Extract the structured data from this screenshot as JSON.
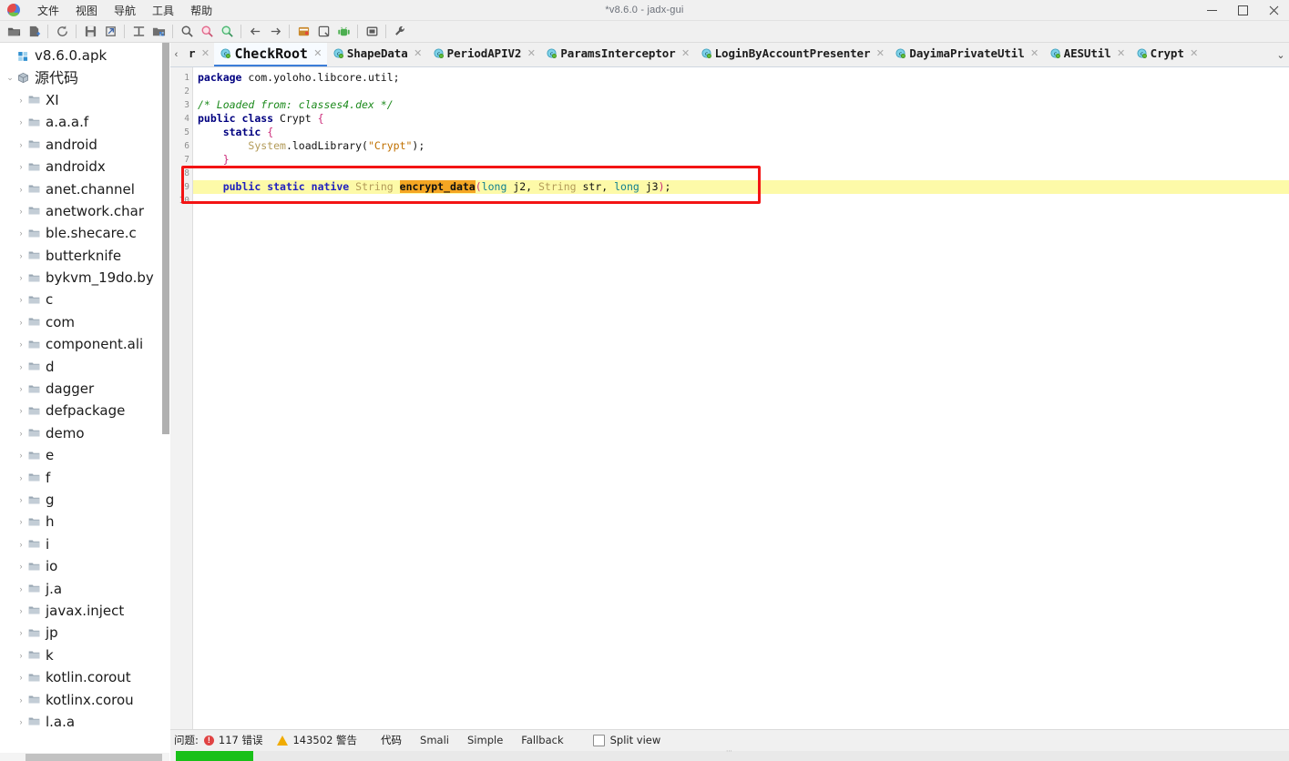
{
  "window": {
    "title": "*v8.6.0 - jadx-gui",
    "minimize": "—",
    "maximize": "▢",
    "close": "✕"
  },
  "menu": {
    "items": [
      {
        "label": "文件"
      },
      {
        "label": "视图"
      },
      {
        "label": "导航"
      },
      {
        "label": "工具"
      },
      {
        "label": "帮助"
      }
    ]
  },
  "toolbar": {
    "buttons": [
      {
        "name": "open-file-icon",
        "title": "打开文件"
      },
      {
        "name": "add-files-icon",
        "title": "添加文件"
      },
      {
        "name": "reload-icon",
        "title": "重新加载"
      },
      {
        "name": "save-icon",
        "title": "保存"
      },
      {
        "name": "export-icon",
        "title": "导出"
      },
      {
        "name": "sync-icon",
        "title": "同步"
      },
      {
        "name": "flat-packages-icon",
        "title": "平铺包"
      },
      {
        "name": "search-icon",
        "title": "搜索"
      },
      {
        "name": "search-class-icon",
        "title": "搜索类"
      },
      {
        "name": "search-comment-icon",
        "title": "搜索注释"
      },
      {
        "name": "back-icon",
        "title": "后退"
      },
      {
        "name": "forward-icon",
        "title": "前进"
      },
      {
        "name": "deobfuscation-icon",
        "title": "反混淆"
      },
      {
        "name": "quark-icon",
        "title": "Quark"
      },
      {
        "name": "android-icon",
        "title": "Android"
      },
      {
        "name": "log-icon",
        "title": "日志"
      },
      {
        "name": "preferences-icon",
        "title": "首选项"
      }
    ]
  },
  "tree": {
    "scroll_left_arrow": "‹",
    "nodes": [
      {
        "level": 0,
        "label": "v8.6.0.apk",
        "icon": "apk-icon",
        "twist": "",
        "cjk": false
      },
      {
        "level": 0,
        "label": "源代码",
        "icon": "source-icon",
        "twist": "⌄",
        "cjk": true
      },
      {
        "level": 1,
        "label": "XI",
        "icon": "package-icon",
        "twist": "›",
        "cjk": false
      },
      {
        "level": 1,
        "label": "a.a.a.f",
        "icon": "package-icon",
        "twist": "›",
        "cjk": false
      },
      {
        "level": 1,
        "label": "android",
        "icon": "package-icon",
        "twist": "›",
        "cjk": false
      },
      {
        "level": 1,
        "label": "androidx",
        "icon": "package-icon",
        "twist": "›",
        "cjk": false
      },
      {
        "level": 1,
        "label": "anet.channel",
        "icon": "package-icon",
        "twist": "›",
        "cjk": false
      },
      {
        "level": 1,
        "label": "anetwork.char",
        "icon": "package-icon",
        "twist": "›",
        "cjk": false
      },
      {
        "level": 1,
        "label": "ble.shecare.c",
        "icon": "package-icon",
        "twist": "›",
        "cjk": false
      },
      {
        "level": 1,
        "label": "butterknife",
        "icon": "package-icon",
        "twist": "›",
        "cjk": false
      },
      {
        "level": 1,
        "label": "bykvm_19do.by",
        "icon": "package-icon",
        "twist": "›",
        "cjk": false
      },
      {
        "level": 1,
        "label": "c",
        "icon": "package-icon",
        "twist": "›",
        "cjk": false
      },
      {
        "level": 1,
        "label": "com",
        "icon": "package-icon",
        "twist": "›",
        "cjk": false
      },
      {
        "level": 1,
        "label": "component.ali",
        "icon": "package-icon",
        "twist": "›",
        "cjk": false
      },
      {
        "level": 1,
        "label": "d",
        "icon": "package-icon",
        "twist": "›",
        "cjk": false
      },
      {
        "level": 1,
        "label": "dagger",
        "icon": "package-icon",
        "twist": "›",
        "cjk": false
      },
      {
        "level": 1,
        "label": "defpackage",
        "icon": "package-icon",
        "twist": "›",
        "cjk": false
      },
      {
        "level": 1,
        "label": "demo",
        "icon": "package-icon",
        "twist": "›",
        "cjk": false
      },
      {
        "level": 1,
        "label": "e",
        "icon": "package-icon",
        "twist": "›",
        "cjk": false
      },
      {
        "level": 1,
        "label": "f",
        "icon": "package-icon",
        "twist": "›",
        "cjk": false
      },
      {
        "level": 1,
        "label": "g",
        "icon": "package-icon",
        "twist": "›",
        "cjk": false
      },
      {
        "level": 1,
        "label": "h",
        "icon": "package-icon",
        "twist": "›",
        "cjk": false
      },
      {
        "level": 1,
        "label": "i",
        "icon": "package-icon",
        "twist": "›",
        "cjk": false
      },
      {
        "level": 1,
        "label": "io",
        "icon": "package-icon",
        "twist": "›",
        "cjk": false
      },
      {
        "level": 1,
        "label": "j.a",
        "icon": "package-icon",
        "twist": "›",
        "cjk": false
      },
      {
        "level": 1,
        "label": "javax.inject",
        "icon": "package-icon",
        "twist": "›",
        "cjk": false
      },
      {
        "level": 1,
        "label": "jp",
        "icon": "package-icon",
        "twist": "›",
        "cjk": false
      },
      {
        "level": 1,
        "label": "k",
        "icon": "package-icon",
        "twist": "›",
        "cjk": false
      },
      {
        "level": 1,
        "label": "kotlin.corout",
        "icon": "package-icon",
        "twist": "›",
        "cjk": false
      },
      {
        "level": 1,
        "label": "kotlinx.corou",
        "icon": "package-icon",
        "twist": "›",
        "cjk": false
      },
      {
        "level": 1,
        "label": "l.a.a",
        "icon": "package-icon",
        "twist": "›",
        "cjk": false
      }
    ]
  },
  "tabs": {
    "scroll_left": "‹",
    "overflow_menu": "⌄",
    "close_glyph": "✕",
    "items": [
      {
        "label": "r",
        "active": false,
        "partial": true
      },
      {
        "label": "CheckRoot",
        "active": true,
        "partial": false
      },
      {
        "label": "ShapeData",
        "active": false,
        "partial": false
      },
      {
        "label": "PeriodAPIV2",
        "active": false,
        "partial": false
      },
      {
        "label": "ParamsInterceptor",
        "active": false,
        "partial": false
      },
      {
        "label": "LoginByAccountPresenter",
        "active": false,
        "partial": false
      },
      {
        "label": "DayimaPrivateUtil",
        "active": false,
        "partial": false
      },
      {
        "label": "AESUtil",
        "active": false,
        "partial": false
      },
      {
        "label": "Crypt",
        "active": false,
        "partial": false
      }
    ]
  },
  "editor": {
    "line_numbers": [
      "1",
      "2",
      "3",
      "4",
      "5",
      "6",
      "7",
      "8",
      "9",
      "10"
    ],
    "highlighted_line": 9,
    "highlighted_symbol": "encrypt_data",
    "highlight_color": "#fdfaa8",
    "symbol_highlight_color": "#f5a623",
    "annotation_box_color": "#f31414",
    "lines": [
      {
        "n": 1,
        "tokens": [
          {
            "t": "package",
            "c": "k"
          },
          {
            "t": " com.yoloho.libcore.util;",
            "c": "plain"
          }
        ]
      },
      {
        "n": 2,
        "tokens": []
      },
      {
        "n": 3,
        "tokens": [
          {
            "t": "/* Loaded from: classes4.dex */",
            "c": "cm"
          }
        ]
      },
      {
        "n": 4,
        "tokens": [
          {
            "t": "public",
            "c": "k"
          },
          {
            "t": " ",
            "c": "plain"
          },
          {
            "t": "class",
            "c": "k"
          },
          {
            "t": " Crypt ",
            "c": "plain"
          },
          {
            "t": "{",
            "c": "br"
          }
        ]
      },
      {
        "n": 5,
        "tokens": [
          {
            "t": "    ",
            "c": "plain"
          },
          {
            "t": "static",
            "c": "k"
          },
          {
            "t": " ",
            "c": "plain"
          },
          {
            "t": "{",
            "c": "br"
          }
        ]
      },
      {
        "n": 6,
        "tokens": [
          {
            "t": "        ",
            "c": "plain"
          },
          {
            "t": "System",
            "c": "ty"
          },
          {
            "t": ".loadLibrary(",
            "c": "plain"
          },
          {
            "t": "\"Crypt\"",
            "c": "st"
          },
          {
            "t": ");",
            "c": "plain"
          }
        ]
      },
      {
        "n": 7,
        "tokens": [
          {
            "t": "    ",
            "c": "plain"
          },
          {
            "t": "}",
            "c": "br"
          }
        ]
      },
      {
        "n": 8,
        "tokens": []
      },
      {
        "n": 9,
        "tokens": [
          {
            "t": "    ",
            "c": "plain"
          },
          {
            "t": "public",
            "c": "kw2"
          },
          {
            "t": " ",
            "c": "plain"
          },
          {
            "t": "static",
            "c": "kw2"
          },
          {
            "t": " ",
            "c": "plain"
          },
          {
            "t": "native",
            "c": "kw2"
          },
          {
            "t": " ",
            "c": "plain"
          },
          {
            "t": "String",
            "c": "ty"
          },
          {
            "t": " ",
            "c": "plain"
          },
          {
            "t": "encrypt_data",
            "c": "hi-sym"
          },
          {
            "t": "(",
            "c": "br"
          },
          {
            "t": "long",
            "c": "pn"
          },
          {
            "t": " j2, ",
            "c": "plain"
          },
          {
            "t": "String",
            "c": "ty"
          },
          {
            "t": " str, ",
            "c": "plain"
          },
          {
            "t": "long",
            "c": "pn"
          },
          {
            "t": " j3",
            "c": "plain"
          },
          {
            "t": ")",
            "c": "br"
          },
          {
            "t": ";",
            "c": "plain"
          }
        ]
      },
      {
        "n": 10,
        "tokens": []
      }
    ]
  },
  "statusbar": {
    "problems_label": "问题:",
    "errors": "117 错误",
    "warnings": "143502 警告",
    "view_tabs": [
      {
        "label": "代码",
        "active": true
      },
      {
        "label": "Smali",
        "active": false
      },
      {
        "label": "Simple",
        "active": false
      },
      {
        "label": "Fallback",
        "active": false
      }
    ],
    "split_view_label": "Split view",
    "split_view_checked": false
  },
  "progress": {
    "caption": "",
    "grip": "⋯",
    "fill_color": "#18c018",
    "percent": 6
  }
}
